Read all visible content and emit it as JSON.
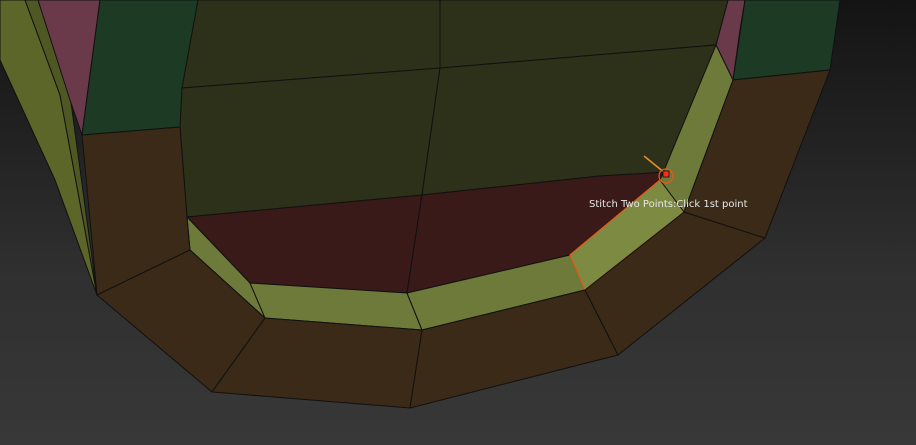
{
  "viewport": {
    "tool_tooltip": "Stitch Two Points:Click 1st point"
  },
  "colors": {
    "background": "#2e2e2e",
    "face_green_dark": "#1c3a24",
    "face_olive": "#2d3119",
    "face_maroon": "#3a1a18",
    "face_brown": "#3a2a17",
    "face_yellow_green": "#6e7a3a",
    "face_pink": "#6a3a4a",
    "edge": "#111111",
    "selection_highlight": "#e65a1a",
    "cursor_marker": "#ff2a1a"
  },
  "cursor": {
    "icon": "stitch-target-icon"
  }
}
